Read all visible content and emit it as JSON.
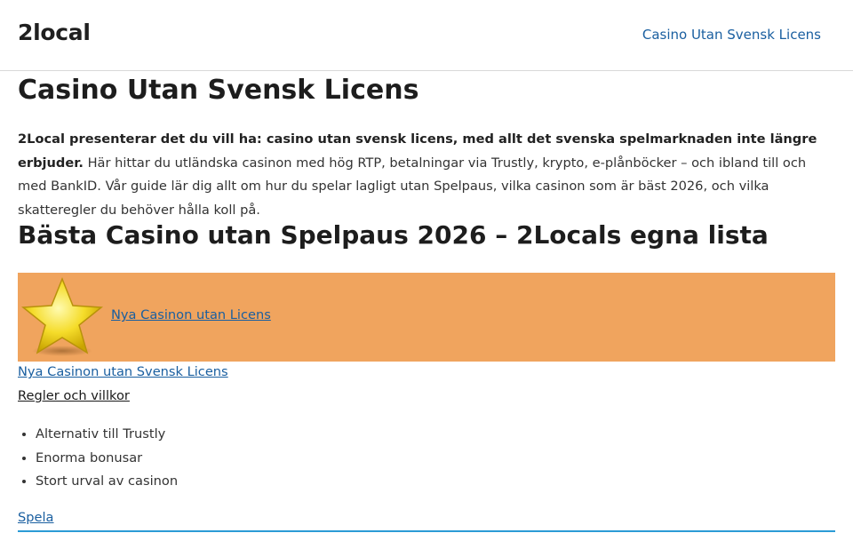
{
  "header": {
    "logo": "2local",
    "nav_link": "Casino Utan Svensk Licens"
  },
  "main": {
    "title": "Casino Utan Svensk Licens",
    "intro_bold": "2Local presenterar det du vill ha: casino utan svensk licens, med allt det svenska spelmarknaden inte längre erbjuder.",
    "intro_rest": " Här hittar du utländska casinon med hög RTP, betalningar via Trustly, krypto, e-plånböcker – och ibland till och med BankID. Vår guide lär dig allt om hur du spelar lagligt utan Spelpaus, vilka casinon som är bäst 2026, och vilka skatteregler du behöver hålla koll på.",
    "section_title": "Bästa Casino utan Spelpaus 2026 – 2Locals egna lista",
    "banner": {
      "link": "Nya Casinon utan Licens",
      "icon": "star-icon",
      "background": "#f0a45e"
    },
    "sub_link": "Nya Casinon utan Svensk Licens",
    "terms_link": "Regler och villkor",
    "features": [
      "Alternativ till Trustly",
      "Enorma bonusar",
      "Stort urval av casinon"
    ],
    "play_link": "Spela"
  },
  "colors": {
    "link": "#1a5fa0",
    "accent_rule": "#2b9bd6"
  }
}
